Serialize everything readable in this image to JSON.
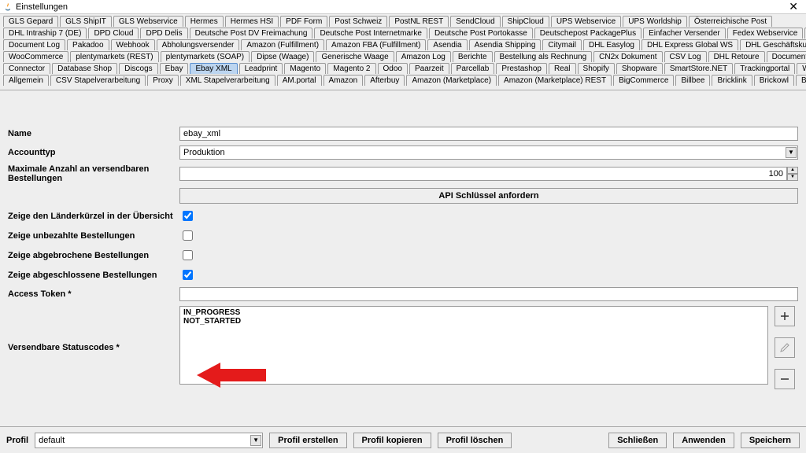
{
  "window": {
    "title": "Einstellungen",
    "close": "✕"
  },
  "tabs": {
    "row1": [
      "GLS Gepard",
      "GLS ShipIT",
      "GLS Webservice",
      "Hermes",
      "Hermes HSI",
      "PDF Form",
      "Post Schweiz",
      "PostNL REST",
      "SendCloud",
      "ShipCloud",
      "UPS Webservice",
      "UPS Worldship",
      "Österreichische Post"
    ],
    "row2": [
      "DHL Intraship 7 (DE)",
      "DPD Cloud",
      "DPD Delis",
      "Deutsche Post DV Freimachung",
      "Deutsche Post Internetmarke",
      "Deutsche Post Portokasse",
      "Deutschepost PackagePlus",
      "Einfacher Versender",
      "Fedex Webservice",
      "GEL Express"
    ],
    "row3": [
      "Document Log",
      "Pakadoo",
      "Webhook",
      "Abholungsversender",
      "Amazon (Fulfillment)",
      "Amazon FBA (Fulfillment)",
      "Asendia",
      "Asendia Shipping",
      "Citymail",
      "DHL Easylog",
      "DHL Express Global WS",
      "DHL Geschäftskundenversand"
    ],
    "row4": [
      "WooCommerce",
      "plentymarkets (REST)",
      "plentymarkets (SOAP)",
      "Dipse (Waage)",
      "Generische Waage",
      "Amazon Log",
      "Berichte",
      "Bestellung als Rechnung",
      "CN2x Dokument",
      "CSV Log",
      "DHL Retoure",
      "Document Downloader"
    ],
    "row5": [
      "Connector",
      "Database Shop",
      "Discogs",
      "Ebay",
      "Ebay XML",
      "Leadprint",
      "Magento",
      "Magento 2",
      "Odoo",
      "Paarzeit",
      "Parcellab",
      "Prestashop",
      "Real",
      "Shopify",
      "Shopware",
      "SmartStore.NET",
      "Trackingportal",
      "Weclapp"
    ],
    "row6": [
      "Allgemein",
      "CSV Stapelverarbeitung",
      "Proxy",
      "XML Stapelverarbeitung",
      "AM.portal",
      "Amazon",
      "Afterbuy",
      "Amazon (Marketplace)",
      "Amazon (Marketplace) REST",
      "BigCommerce",
      "Billbee",
      "Bricklink",
      "Brickowl",
      "Brickscout"
    ]
  },
  "activeTab": "Ebay XML",
  "form": {
    "name_label": "Name",
    "name_value": "ebay_xml",
    "accounttype_label": "Accounttyp",
    "accounttype_value": "Produktion",
    "maxorders_label": "Maximale Anzahl an versendbaren Bestellungen",
    "maxorders_value": "100",
    "api_button": "API Schlüssel anfordern",
    "show_country_label": "Zeige den Länderkürzel in der Übersicht",
    "show_unpaid_label": "Zeige unbezahlte Bestellungen",
    "show_cancelled_label": "Zeige abgebrochene Bestellungen",
    "show_completed_label": "Zeige abgeschlossene Bestellungen",
    "access_token_label": "Access Token *",
    "statuscodes_label": "Versendbare Statuscodes *",
    "statuscodes": [
      "IN_PROGRESS",
      "NOT_STARTED"
    ]
  },
  "footer": {
    "profile_label": "Profil",
    "profile_value": "default",
    "create": "Profil erstellen",
    "copy": "Profil kopieren",
    "delete": "Profil löschen",
    "close": "Schließen",
    "apply": "Anwenden",
    "save": "Speichern"
  }
}
